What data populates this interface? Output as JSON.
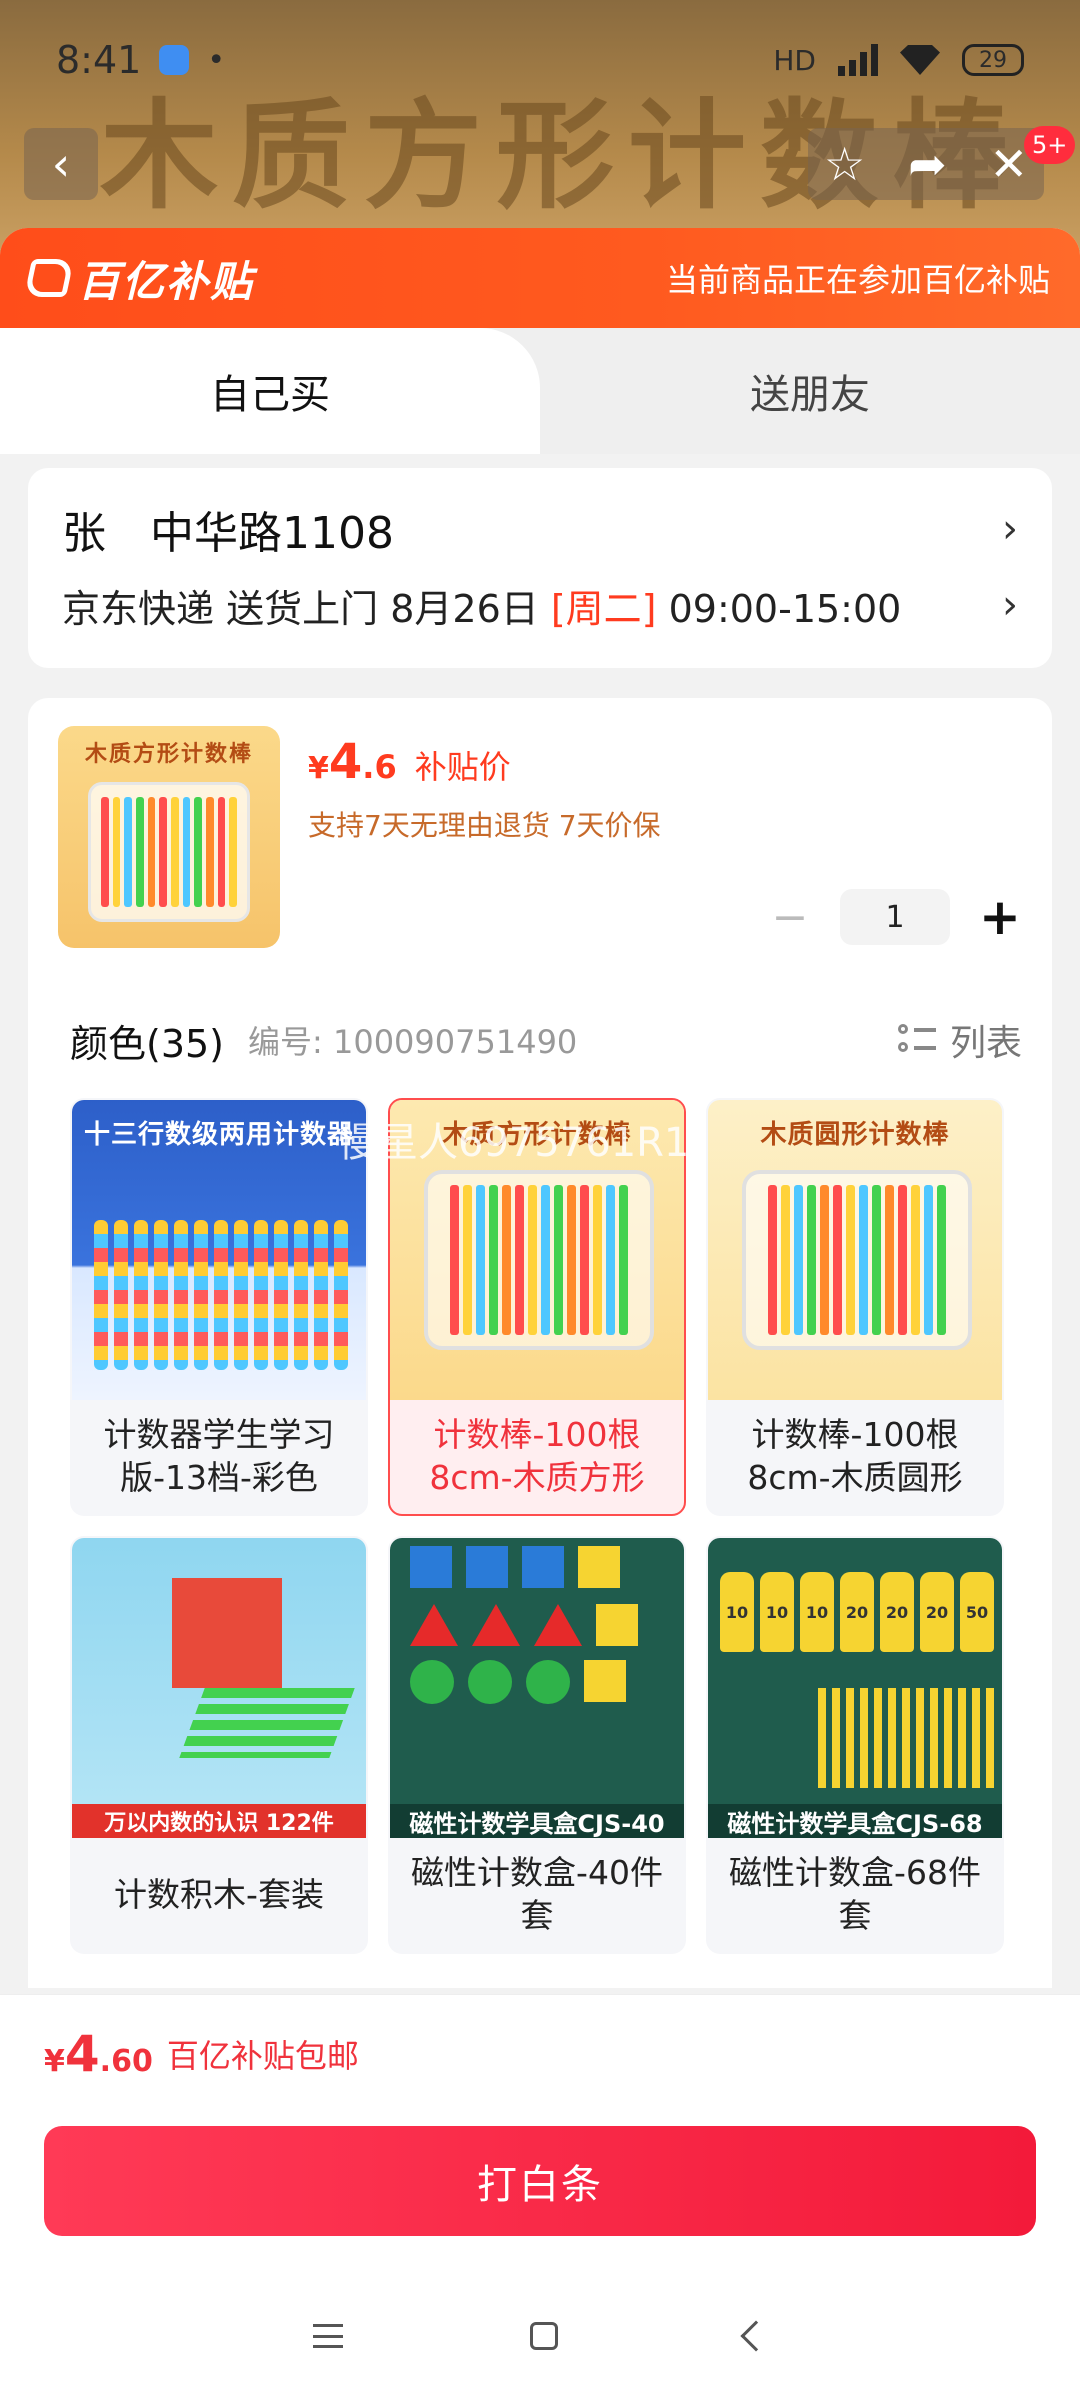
{
  "status_bar": {
    "time": "8:41",
    "dot": "•",
    "network": "HD",
    "battery": "29"
  },
  "hero": {
    "title": "木质方形计数棒",
    "badge": "5+"
  },
  "banner": {
    "logo": "百亿补贴",
    "note": "当前商品正在参加百亿补贴"
  },
  "tabs": [
    {
      "label": "自己买"
    },
    {
      "label": "送朋友"
    }
  ],
  "address": {
    "name": "张",
    "street": "中华路1108",
    "carrier": "京东快递",
    "delivery": "送货上门",
    "date": "8月26日",
    "weekday": "[周二]",
    "time_window": "09:00-15:00"
  },
  "product": {
    "thumb_label": "木质方形计数棒",
    "price_yen": "¥",
    "price_int": "4",
    "price_dec": ".6",
    "price_tag": "补贴价",
    "service": "支持7天无理由退货  7天价保",
    "quantity": "1"
  },
  "spec": {
    "title": "颜色(35)",
    "code": "编号: 100090751490",
    "list_label": "列表"
  },
  "options": [
    {
      "label": "计数器学生学习版-13档-彩色",
      "caption": "十三行数级两用计数器",
      "selected": false
    },
    {
      "label": "计数棒-100根8cm-木质方形",
      "caption": "木质方形计数棒",
      "selected": true
    },
    {
      "label": "计数棒-100根8cm-木质圆形",
      "caption": "木质圆形计数棒",
      "selected": false
    },
    {
      "label": "计数积木-套装",
      "caption": "万以内数的认识 122件",
      "selected": false
    },
    {
      "label": "磁性计数盒-40件套",
      "caption": "磁性计数学具盒CJS-40",
      "selected": false
    },
    {
      "label": "磁性计数盒-68件套",
      "caption": "磁性计数学具盒CJS-68",
      "selected": false
    }
  ],
  "watermark": "慢星人6975761R1",
  "pay": {
    "yen": "¥",
    "int": "4",
    "dec": ".60",
    "note": "百亿补贴包邮",
    "button": "打白条"
  },
  "colors": {
    "brand_orange": "#ff4d1a",
    "price_red": "#f0323c",
    "button_red": "#f31a3a"
  }
}
